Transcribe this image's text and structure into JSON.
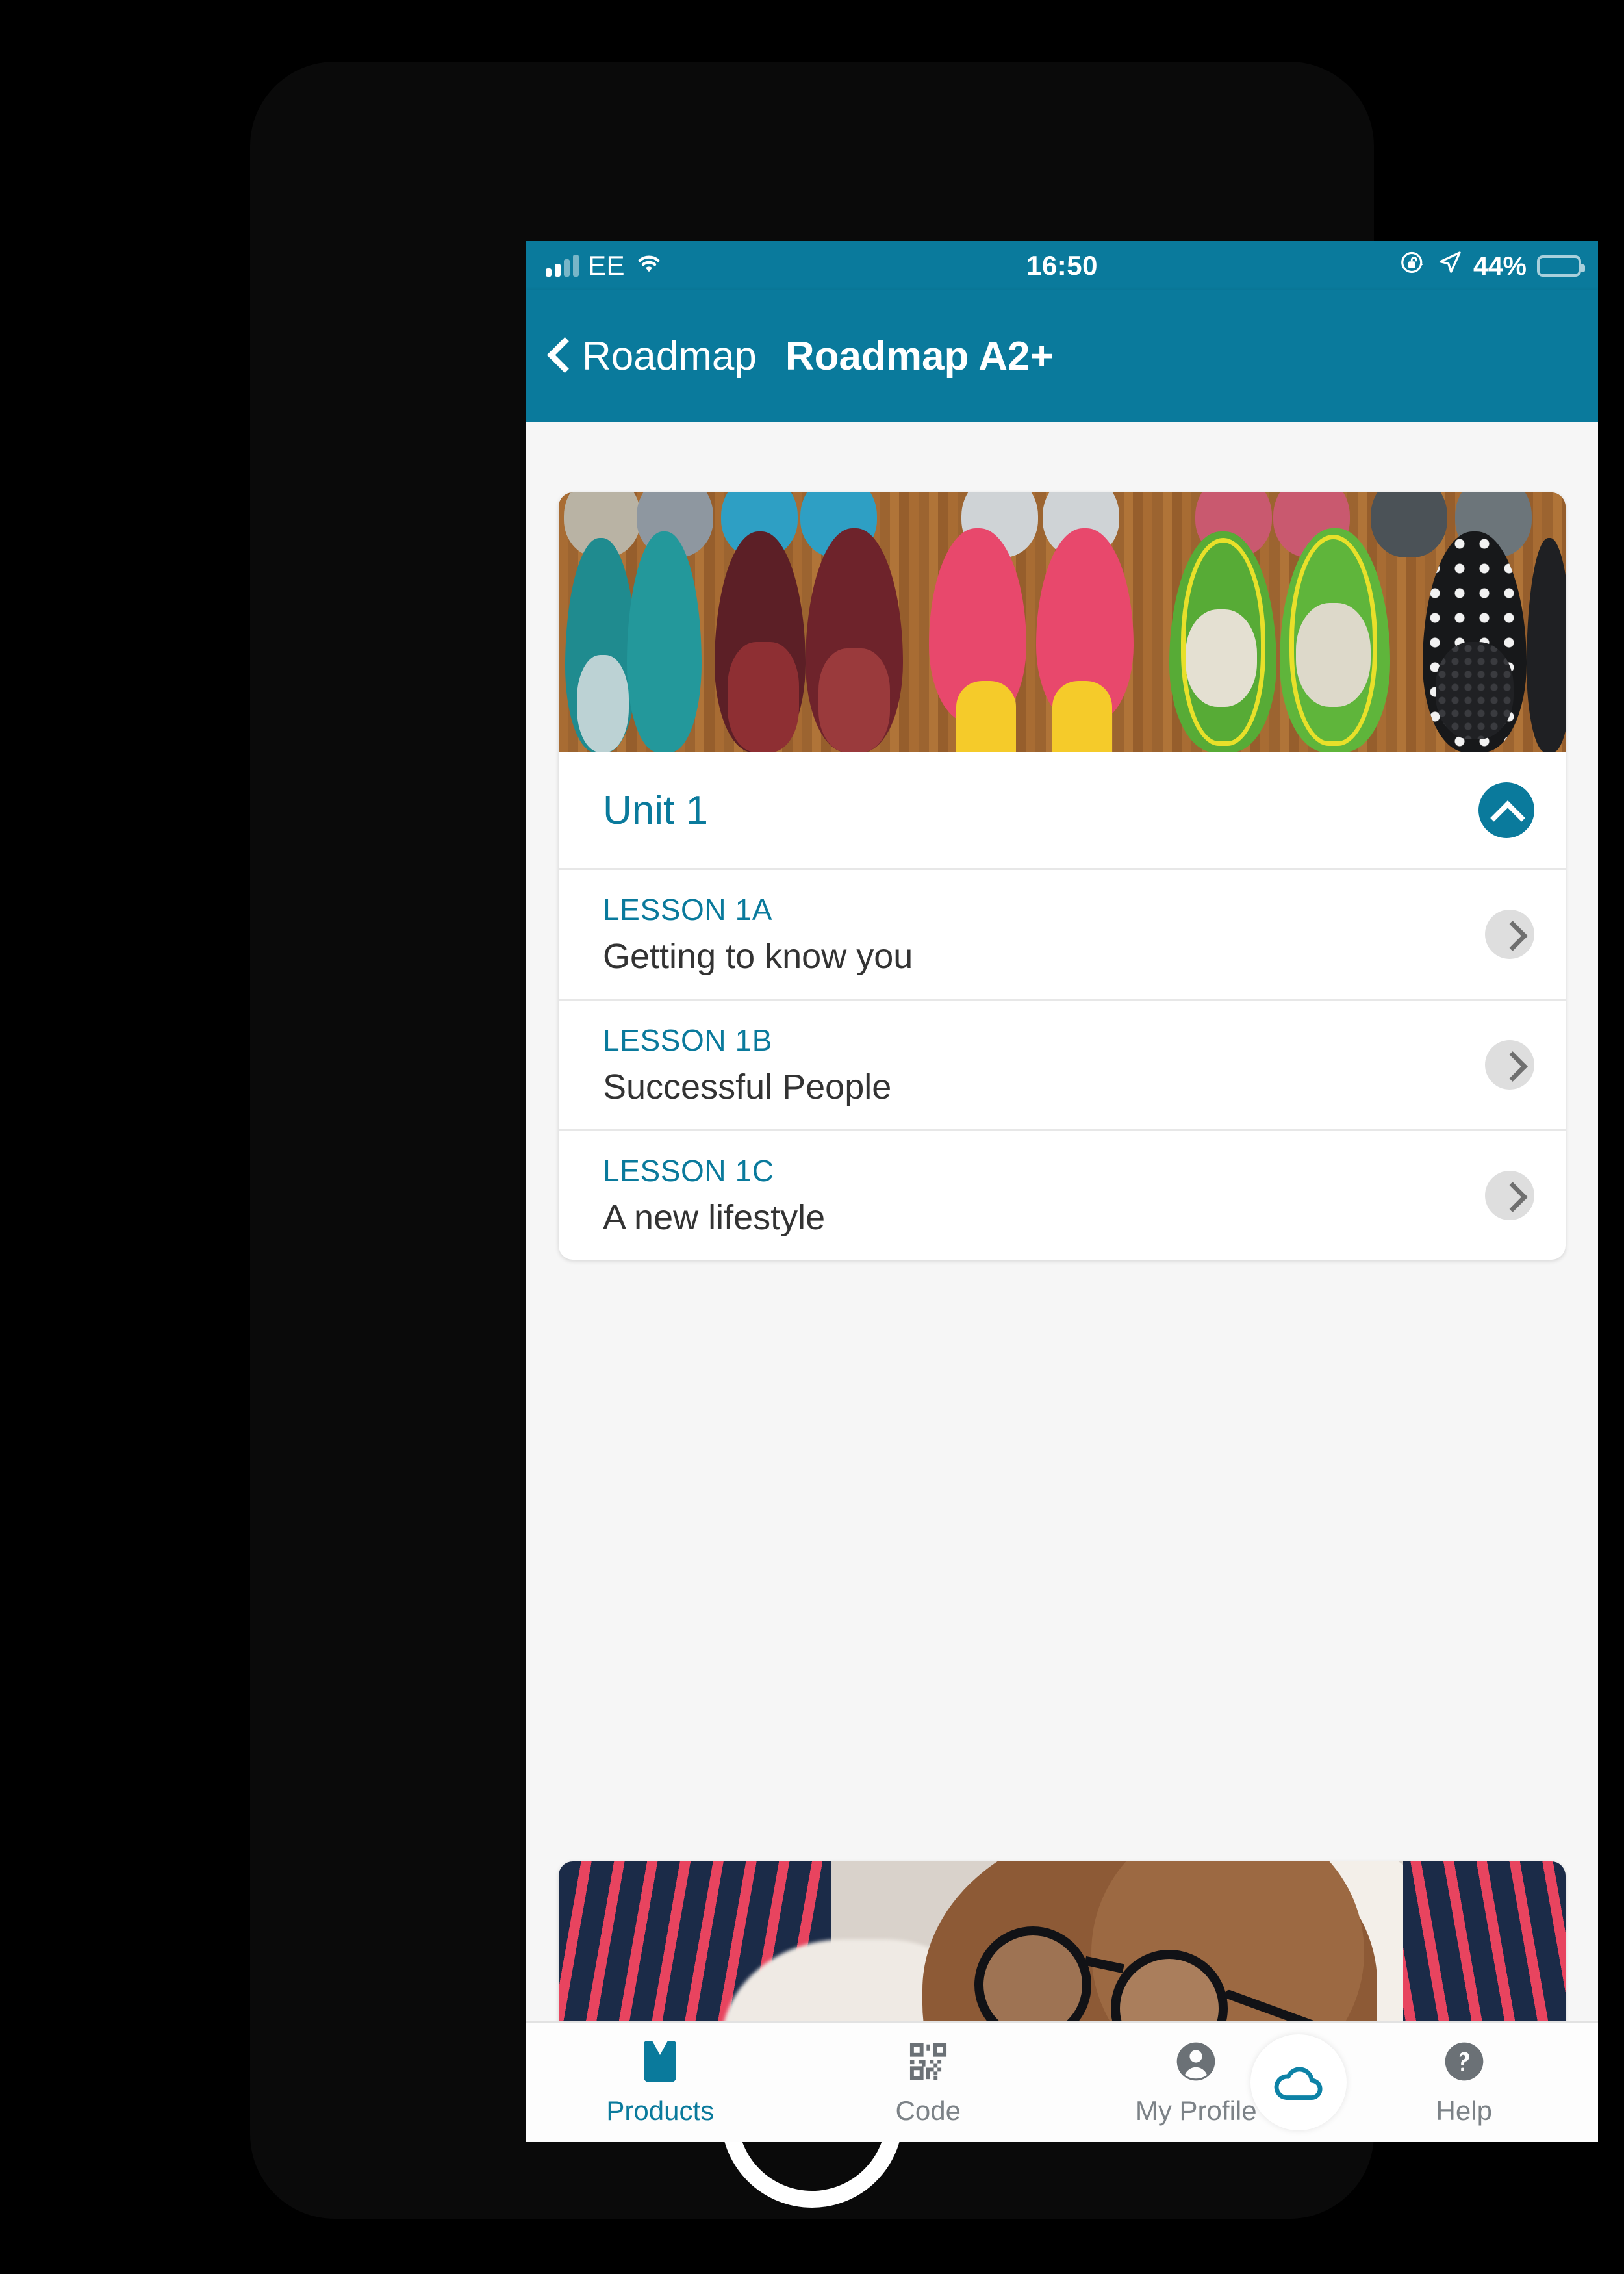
{
  "status_bar": {
    "carrier": "EE",
    "time": "16:50",
    "battery_percent": "44%",
    "battery_level": 44,
    "icons": [
      "signal-bars-icon",
      "wifi-icon",
      "rotation-lock-icon",
      "location-arrow-icon",
      "battery-icon"
    ]
  },
  "nav": {
    "back_label": "Roadmap",
    "title": "Roadmap A2+"
  },
  "colors": {
    "brand_teal": "#0a7a9c",
    "text_dark": "#333333",
    "muted_gray": "#7c8287",
    "divider": "#e7e7e7",
    "page_bg": "#f6f6f6"
  },
  "units": [
    {
      "title": "Unit 1",
      "expanded": true,
      "collapse_icon": "chevron-up-icon",
      "image_alt": "rows of colourful shoes on a wooden floor",
      "lessons": [
        {
          "code": "LESSON 1A",
          "name": "Getting to know you",
          "chevron": "chevron-right-icon"
        },
        {
          "code": "LESSON 1B",
          "name": "Successful People",
          "chevron": "chevron-right-icon"
        },
        {
          "code": "LESSON 1C",
          "name": "A new lifestyle",
          "chevron": "chevron-right-icon"
        }
      ]
    },
    {
      "title": "",
      "expanded": false,
      "image_alt": "man with glasses lying down on a pillow wearing a striped shirt",
      "lessons": []
    }
  ],
  "fab": {
    "icon": "cloud-icon",
    "label": ""
  },
  "tabbar": {
    "items": [
      {
        "label": "Products",
        "icon": "book-icon",
        "active": true
      },
      {
        "label": "Code",
        "icon": "qr-code-icon",
        "active": false
      },
      {
        "label": "My Profile",
        "icon": "user-circle-icon",
        "active": false
      },
      {
        "label": "Help",
        "icon": "question-circle-icon",
        "active": false
      }
    ]
  }
}
